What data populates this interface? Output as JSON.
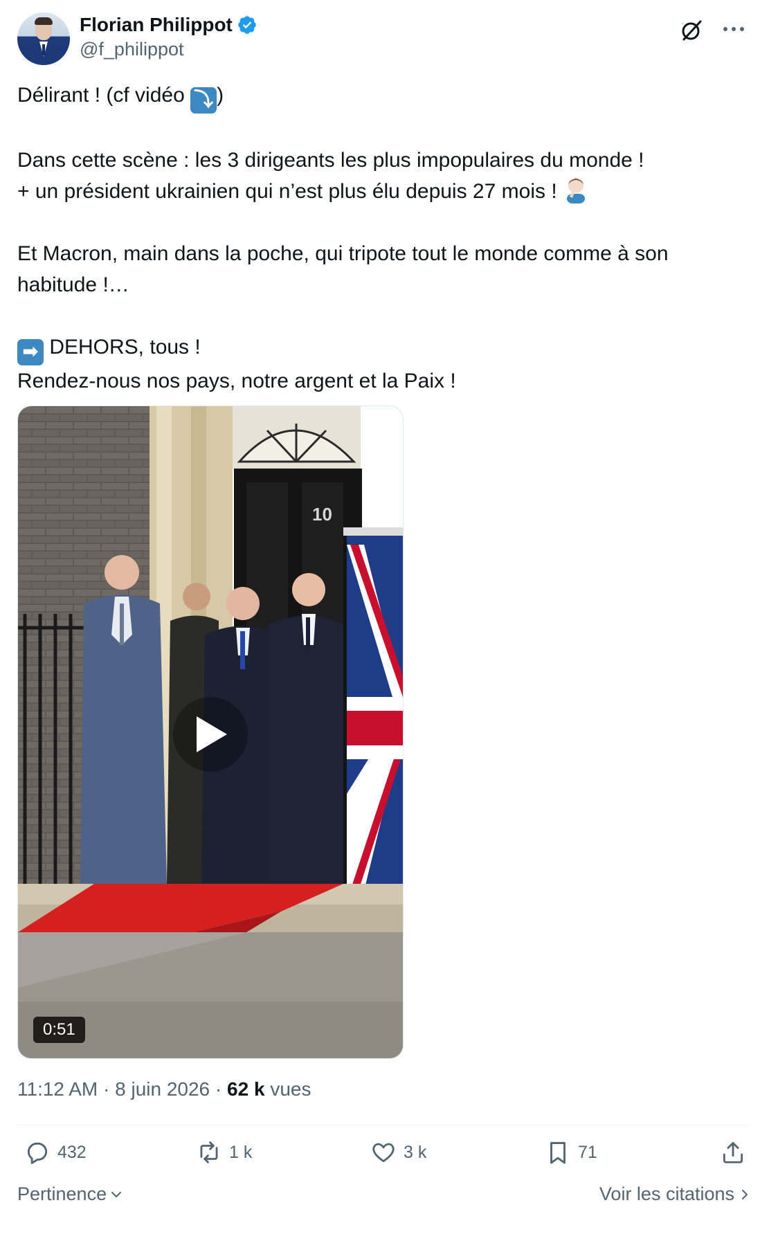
{
  "author": {
    "name": "Florian Philippot",
    "handle": "@f_philippot"
  },
  "tweet": {
    "line1_before": "Délirant ! (cf vidéo ",
    "line1_emoji": "⤵",
    "line1_after": ")",
    "line2": "Dans cette scène : les 3 dirigeants les plus impopulaires du monde !",
    "line3": "+ un président ukrainien qui n’est plus élu depuis 27 mois ! ",
    "line4": "Et Macron, main dans la poche, qui tripote tout le monde comme à son habitude !…",
    "line5_emoji": "➡",
    "line5": " DEHORS, tous !",
    "line6": "Rendez-nous nos pays, notre argent et la Paix !"
  },
  "media": {
    "duration": "0:51",
    "door_number": "10"
  },
  "meta": {
    "time": "11:12 AM",
    "date": "8 juin 2026",
    "views_count": "62 k",
    "views_label": "vues"
  },
  "actions": {
    "replies": "432",
    "reposts": "1 k",
    "likes": "3 k",
    "bookmarks": "71"
  },
  "footer": {
    "sort_label": "Pertinence",
    "quotes_label": "Voir les citations"
  },
  "colors": {
    "text": "#0f1419",
    "secondary": "#536471",
    "verified": "#1d9bf0",
    "emoji_blue": "#3b88c3"
  }
}
